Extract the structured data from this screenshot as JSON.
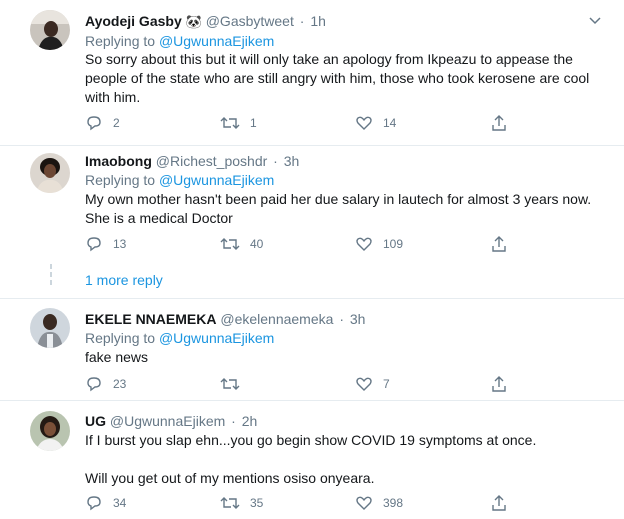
{
  "tweets": [
    {
      "name": "Ayodeji Gasby",
      "emoji": "🐼",
      "handle": "@Gasbytweet",
      "time": "1h",
      "replying_label": "Replying to",
      "replying_to": "@UgwunnaEjikem",
      "text": [
        "So sorry about this but it will only take an apology from Ikpeazu to appease the people of the state who are still angry with him, those who took kerosene are cool with him."
      ],
      "replies": "2",
      "retweets": "1",
      "likes": "14"
    },
    {
      "name": "Imaobong",
      "handle": "@Richest_poshdr",
      "time": "3h",
      "replying_label": "Replying to",
      "replying_to": "@UgwunnaEjikem",
      "text": [
        "My own mother hasn't been paid her due salary in lautech for almost 3 years now. She is a medical Doctor"
      ],
      "replies": "13",
      "retweets": "40",
      "likes": "109"
    },
    {
      "name": "EKELE NNAEMEKA",
      "handle": "@ekelennaemeka",
      "time": "3h",
      "replying_label": "Replying to",
      "replying_to": "@UgwunnaEjikem",
      "text": [
        "fake news"
      ],
      "replies": "23",
      "retweets": "",
      "likes": "7"
    },
    {
      "name": "UG",
      "handle": "@UgwunnaEjikem",
      "time": "2h",
      "text": [
        "If I burst you slap ehn...you go begin show COVID 19 symptoms at once.",
        "Will you get out of my mentions osiso onyeara."
      ],
      "replies": "34",
      "retweets": "35",
      "likes": "398"
    }
  ],
  "more_replies_label": "1 more reply",
  "colors": {
    "link": "#1b95e0",
    "muted": "#657786",
    "text": "#14171a",
    "separator": "#e6ecf0"
  },
  "icons": [
    "reply-icon",
    "retweet-icon",
    "like-icon",
    "share-icon",
    "caret-down-icon"
  ]
}
